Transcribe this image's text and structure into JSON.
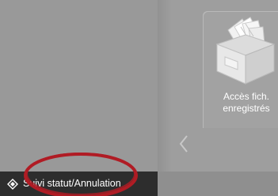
{
  "tiles": [
    {
      "label_line1": "Accès fich.",
      "label_line2": "enregistrés",
      "icon": "file-box-icon"
    }
  ],
  "navigation": {
    "prev_icon": "chevron-left-icon"
  },
  "status_bar": {
    "label": "Suivi statut/Annulation",
    "icon": "status-monitor-icon"
  },
  "colors": {
    "background": "#9a9a9a",
    "bottom_bar": "#2d2d2d",
    "highlight": "#b01c24",
    "text": "#ffffff"
  }
}
